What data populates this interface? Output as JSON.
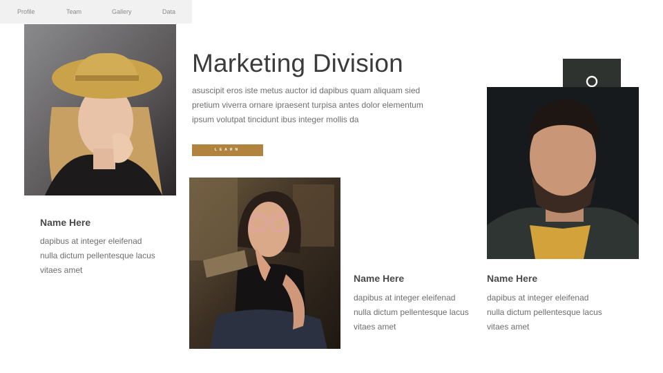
{
  "nav": {
    "items": [
      {
        "label": "Profile"
      },
      {
        "label": "Team"
      },
      {
        "label": "Gallery"
      },
      {
        "label": "Data"
      }
    ]
  },
  "header": {
    "title": "Marketing Division",
    "description": "asuscipit eros iste metus auctor id dapibus quam aliquam sied pretium viverra ornare ipraesent turpisa antes dolor elementum ipsum volutpat tincidunt ibus integer mollis da",
    "learn_label": "LEARN"
  },
  "accent_color": "#b0843e",
  "icon_box_color": "#2e332f",
  "icons": {
    "team_icon": "people-icon"
  },
  "members": [
    {
      "name": "Name Here",
      "text": "dapibus at integer eleifenad nulla dictum pellentesque lacus vitaes amet"
    },
    {
      "name": "Name Here",
      "text": "dapibus at integer eleifenad nulla dictum pellentesque lacus vitaes amet"
    },
    {
      "name": "Name Here",
      "text": "dapibus at integer eleifenad nulla dictum pellentesque lacus vitaes amet"
    }
  ]
}
